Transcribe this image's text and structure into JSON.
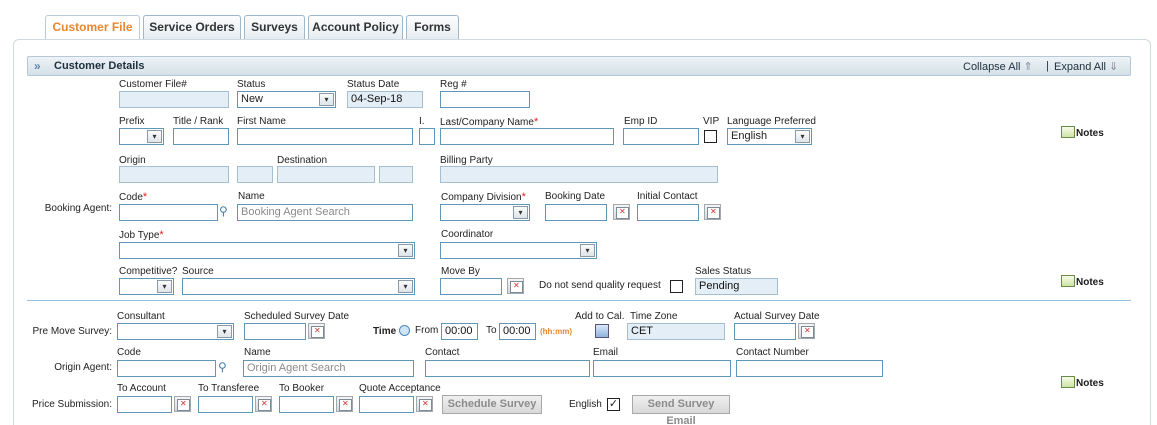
{
  "tabs": [
    "Customer File",
    "Service Orders",
    "Surveys",
    "Account Policy",
    "Forms"
  ],
  "header": {
    "title": "Customer Details",
    "collapse": "Collapse All",
    "expand": "Expand All",
    "sep": "|"
  },
  "labels": {
    "customer_file": "Customer File#",
    "status": "Status",
    "status_date": "Status Date",
    "reg": "Reg #",
    "prefix": "Prefix",
    "title_rank": "Title / Rank",
    "first_name": "First Name",
    "initial": "I.",
    "last_name": "Last/Company Name",
    "emp_id": "Emp ID",
    "vip": "VIP",
    "language": "Language Preferred",
    "origin": "Origin",
    "destination": "Destination",
    "billing_party": "Billing Party",
    "booking_agent": "Booking Agent:",
    "code": "Code",
    "name": "Name",
    "company_division": "Company Division",
    "booking_date": "Booking Date",
    "initial_contact": "Initial Contact",
    "job_type": "Job Type",
    "coordinator": "Coordinator",
    "competitive": "Competitive?",
    "source": "Source",
    "move_by": "Move By",
    "no_quality": "Do not send quality request",
    "sales_status": "Sales Status",
    "pre_move_survey": "Pre Move Survey:",
    "consultant": "Consultant",
    "scheduled_survey_date": "Scheduled Survey Date",
    "time": "Time",
    "from": "From",
    "to": "To",
    "hhmm": "(hh:mm)",
    "add_to_cal": "Add to Cal.",
    "time_zone": "Time Zone",
    "actual_survey_date": "Actual Survey Date",
    "origin_agent": "Origin Agent:",
    "code2": "Code",
    "name2": "Name",
    "contact": "Contact",
    "email": "Email",
    "contact_number": "Contact Number",
    "price_submission": "Price Submission:",
    "to_account": "To Account",
    "to_transferee": "To Transferee",
    "to_booker": "To Booker",
    "quote_acceptance": "Quote Acceptance",
    "english": "English",
    "notes": "Notes",
    "req": "*"
  },
  "values": {
    "status": "New",
    "status_date": "04-Sep-18",
    "language": "English",
    "booking_agent_placeholder": "Booking Agent Search",
    "sales_status": "Pending",
    "from_time": "00:00",
    "to_time": "00:00",
    "time_zone": "CET",
    "origin_agent_placeholder": "Origin Agent Search",
    "english_checked": "✓"
  },
  "buttons": {
    "schedule_survey": "Schedule Survey",
    "send_survey_email": "Send Survey Email"
  },
  "icons": {
    "collapse": "⇑",
    "expand": "⇓",
    "chevron": "»",
    "arrow": "▾",
    "mag": "🔍"
  }
}
